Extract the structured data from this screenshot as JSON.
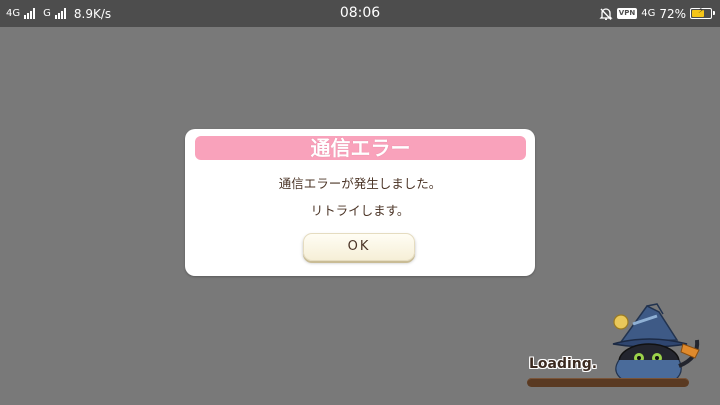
{
  "status_bar": {
    "net1": "4G",
    "net2": "G",
    "speed": "8.9K/s",
    "time": "08:06",
    "vpn": "VPN",
    "net3": "4G",
    "battery_pct": "72%",
    "battery_level": 0.72,
    "icons": [
      "signal-icon",
      "signal-icon",
      "alarm-off-icon",
      "vpn-icon",
      "battery-charging-icon"
    ]
  },
  "dialog": {
    "title": "通信エラー",
    "message_line1": "通信エラーが発生しました。",
    "message_line2": "リトライします。",
    "ok_label": "OK"
  },
  "loading": {
    "label": "Loading.",
    "mascot_icon": "black-cat-wizard-mascot-icon"
  },
  "colors": {
    "background": "#797979",
    "status_bar": "#4d4d4d",
    "dialog_header": "#f9a2bb",
    "text_brown": "#4b3426",
    "loading_bar": "#5a3a22",
    "battery_fill": "#f5c518"
  }
}
